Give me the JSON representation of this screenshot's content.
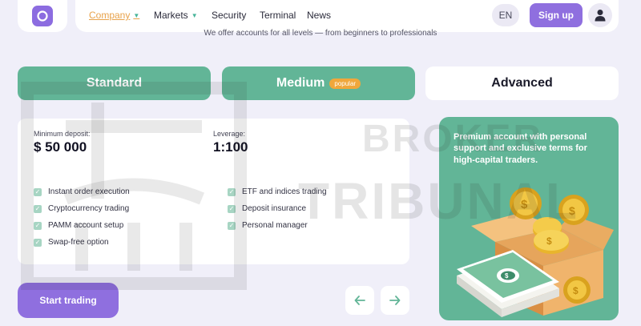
{
  "header": {
    "logo": {
      "icon": "logo-ring-icon",
      "color": "#8c6ce0"
    },
    "nav": [
      {
        "label": "Company",
        "active": true,
        "has_caret": true
      },
      {
        "label": "Markets",
        "active": false,
        "has_caret": true
      },
      {
        "label": "Security",
        "active": false,
        "has_caret": false
      },
      {
        "label": "Terminal",
        "active": false,
        "has_caret": false
      },
      {
        "label": "News",
        "active": false,
        "has_caret": false
      }
    ],
    "lang": "EN",
    "signup_label": "Sign up",
    "user_icon": "user-icon"
  },
  "subtitle": "We offer accounts for all levels — from beginners to professionals",
  "tabs": [
    {
      "label": "Standard",
      "selected": false
    },
    {
      "label": "Medium",
      "badge": "popular",
      "selected": false
    },
    {
      "label": "Advanced",
      "selected": true
    }
  ],
  "account": {
    "min_deposit_label": "Minimum deposit:",
    "min_deposit_value": "$ 50 000",
    "leverage_label": "Leverage:",
    "leverage_value": "1:100",
    "features_left": [
      "Instant order execution",
      "Cryptocurrency trading",
      "PAMM account setup",
      "Swap-free option"
    ],
    "features_right": [
      "ETF and indices trading",
      "Deposit insurance",
      "Personal manager"
    ]
  },
  "actions": {
    "start_label": "Start trading",
    "prev_icon": "arrow-left-icon",
    "next_icon": "arrow-right-icon"
  },
  "promo": {
    "text": "Premium account with personal support and exclusive terms for high-capital traders.",
    "illustration": "money-box-coins-illustration"
  },
  "watermark": {
    "line1": "BROKER",
    "line2": "TRIBUNAL"
  },
  "colors": {
    "accent_purple": "#8f6fdf",
    "accent_green": "#62b597",
    "active_nav": "#e8a24a",
    "badge": "#f0a73b",
    "background": "#f0eff9"
  }
}
